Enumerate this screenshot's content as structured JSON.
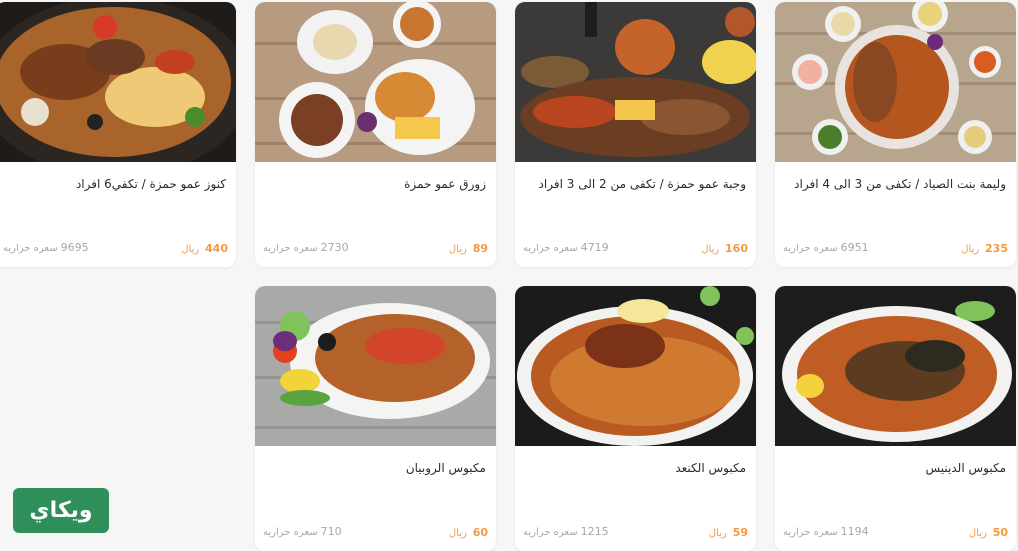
{
  "cards": [
    {
      "name": "كنوز عمو حمزة / تكفي6 افراد",
      "price": "440",
      "currency": "ريال",
      "calories": "9695",
      "cal_unit": "سعره حراريه"
    },
    {
      "name": "زورق عمو حمزة",
      "price": "89",
      "currency": "ريال",
      "calories": "2730",
      "cal_unit": "سعره حراريه"
    },
    {
      "name": "وجبة عمو حمزة / تكفى من 2 الى 3 افراد",
      "price": "160",
      "currency": "ريال",
      "calories": "4719",
      "cal_unit": "سعره حراريه"
    },
    {
      "name": "وليمة بنت الصياد / تكفى من 3 الى 4 افراد",
      "price": "235",
      "currency": "ريال",
      "calories": "6951",
      "cal_unit": "سعره حراريه"
    },
    {
      "name": "مكبوس الروبيان",
      "price": "60",
      "currency": "ريال",
      "calories": "710",
      "cal_unit": "سعره حراريه"
    },
    {
      "name": "مكبوس الكنعد",
      "price": "59",
      "currency": "ريال",
      "calories": "1215",
      "cal_unit": "سعره حراريه"
    },
    {
      "name": "مكبوس الدينيس",
      "price": "50",
      "currency": "ريال",
      "calories": "1194",
      "cal_unit": "سعره حراريه"
    }
  ],
  "logo": {
    "text": "ويكاي"
  },
  "colors": {
    "price": "#f39a3d",
    "logo_bg": "#2f8f5a",
    "page_bg": "#f6f6f6"
  }
}
